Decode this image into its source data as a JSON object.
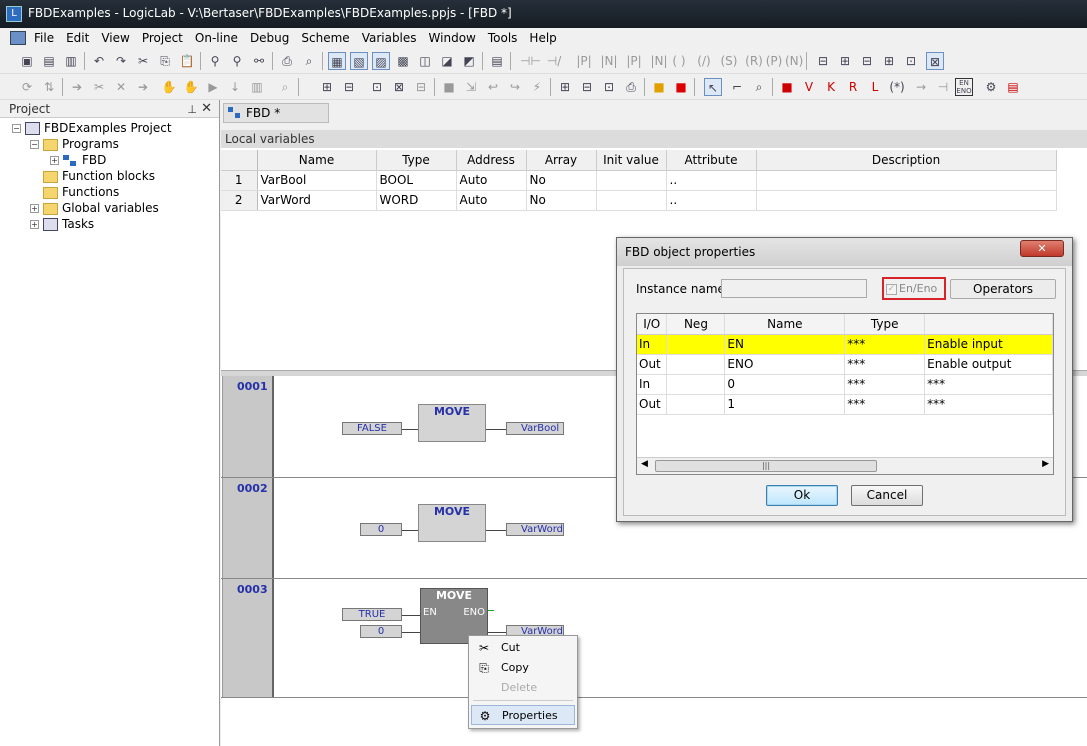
{
  "window": {
    "title": "FBDExamples - LogicLab - V:\\Bertaser\\FBDExamples\\FBDExamples.ppjs - [FBD *]",
    "app_icon": "logiclab-icon"
  },
  "menu": [
    "File",
    "Edit",
    "View",
    "Project",
    "On-line",
    "Debug",
    "Scheme",
    "Variables",
    "Window",
    "Tools",
    "Help"
  ],
  "project_panel": {
    "title": "Project",
    "pin": "⊥",
    "close": "✕",
    "tree": {
      "root": "FBDExamples Project",
      "programs": "Programs",
      "fbd": "FBD",
      "function_blocks": "Function blocks",
      "functions": "Functions",
      "global_variables": "Global variables",
      "tasks": "Tasks"
    }
  },
  "editor_tab": "FBD *",
  "local_variables": {
    "title": "Local variables",
    "columns": [
      "Name",
      "Type",
      "Address",
      "Array",
      "Init value",
      "Attribute",
      "Description"
    ],
    "rows": [
      {
        "num": "1",
        "name": "VarBool",
        "type": "BOOL",
        "address": "Auto",
        "array": "No",
        "init": "",
        "attribute": "..",
        "description": ""
      },
      {
        "num": "2",
        "name": "VarWord",
        "type": "WORD",
        "address": "Auto",
        "array": "No",
        "init": "",
        "attribute": "..",
        "description": ""
      }
    ]
  },
  "networks": [
    {
      "num": "0001",
      "block": "MOVE",
      "input": "FALSE",
      "output": "VarBool"
    },
    {
      "num": "0002",
      "block": "MOVE",
      "input": "0",
      "output": "VarWord"
    },
    {
      "num": "0003",
      "block": "MOVE",
      "en_input": "TRUE",
      "input": "0",
      "output": "VarWord",
      "en_label": "EN",
      "eno_label": "ENO"
    }
  ],
  "dialog": {
    "title": "FBD object properties",
    "close": "✕",
    "instance_label": "Instance name",
    "instance_value": "",
    "en_eno": "En/Eno",
    "operators": "Operators",
    "columns": [
      "I/O",
      "Neg",
      "Name",
      "Type",
      ""
    ],
    "rows": [
      {
        "io": "In",
        "neg": "",
        "name": "EN",
        "type": "***",
        "desc": "Enable input"
      },
      {
        "io": "Out",
        "neg": "",
        "name": "ENO",
        "type": "***",
        "desc": "Enable output"
      },
      {
        "io": "In",
        "neg": "",
        "name": "0",
        "type": "***",
        "desc": "***"
      },
      {
        "io": "Out",
        "neg": "",
        "name": "1",
        "type": "***",
        "desc": "***"
      }
    ],
    "ok": "Ok",
    "cancel": "Cancel"
  },
  "context_menu": {
    "items": [
      {
        "label": "Cut",
        "icon": "scissors-icon",
        "enabled": true
      },
      {
        "label": "Copy",
        "icon": "copy-icon",
        "enabled": true
      },
      {
        "label": "Delete",
        "icon": "",
        "enabled": false
      },
      {
        "label": "Properties",
        "icon": "properties-icon",
        "enabled": true
      }
    ]
  },
  "colors": {
    "highlight": "#ffff00",
    "en_eno_border": "#d9232a",
    "diagram_text": "#2630a8"
  }
}
